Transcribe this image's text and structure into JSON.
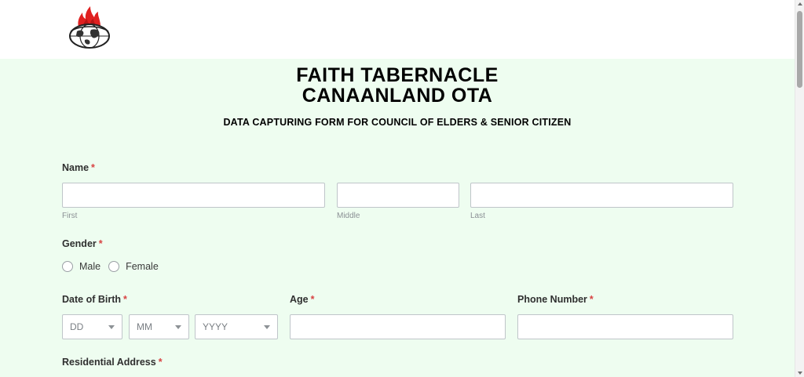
{
  "header": {
    "logo_icon": "church-globe-flame-logo"
  },
  "form": {
    "title_line1": "FAITH TABERNACLE",
    "title_line2": "CANAANLAND OTA",
    "subtitle": "DATA CAPTURING FORM FOR COUNCIL OF ELDERS & SENIOR CITIZEN",
    "required_mark": "*",
    "name": {
      "label": "Name",
      "first_label": "First",
      "middle_label": "Middle",
      "last_label": "Last",
      "first_value": "",
      "middle_value": "",
      "last_value": ""
    },
    "gender": {
      "label": "Gender",
      "options": [
        "Male",
        "Female"
      ]
    },
    "dob": {
      "label": "Date of Birth",
      "day_placeholder": "DD",
      "month_placeholder": "MM",
      "year_placeholder": "YYYY"
    },
    "age": {
      "label": "Age",
      "value": ""
    },
    "phone": {
      "label": "Phone Number",
      "value": ""
    },
    "address": {
      "label": "Residential Address"
    }
  },
  "colors": {
    "form_background": "#eefdf0",
    "required": "#d84343",
    "logo_flame": "#e02020"
  }
}
